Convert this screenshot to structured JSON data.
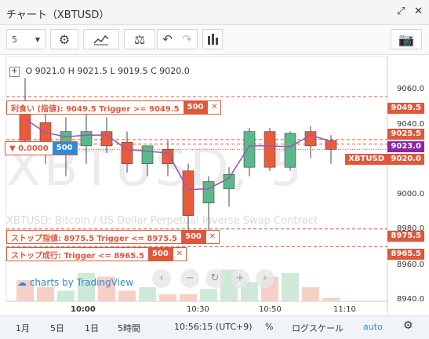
{
  "window": {
    "title": "チャート（XBTUSD）"
  },
  "toolbar": {
    "interval": "5"
  },
  "ohlc": {
    "o_label": "O",
    "o": "9021.0",
    "h_label": "H",
    "h": "9021.5",
    "l_label": "L",
    "l": "9019.5",
    "c_label": "C",
    "c": "9020.0"
  },
  "orders": [
    {
      "text": "利食い (指値): 9049.5 Trigger >= 9049.5",
      "qty": "500"
    },
    {
      "text": "▼ 0.0000",
      "qty": "500"
    },
    {
      "text": "ストップ指値: 8975.5 Trigger <= 8975.5",
      "qty": "500"
    },
    {
      "text": "ストップ成行: Trigger <= 8965.5",
      "qty": "500"
    }
  ],
  "price_axis": {
    "ticks": [
      "9060.0",
      "9040.0",
      "9000.0",
      "8980.0",
      "8960.0",
      "8940.0"
    ]
  },
  "price_tags": {
    "tp": "9049.5",
    "t1": "9025.5",
    "t2": "9023.0",
    "xbt": "XBTUSD",
    "last": "9020.0",
    "sl1": "8975.5",
    "sl2": "8965.5"
  },
  "time_axis": {
    "ticks": [
      "10:00",
      "10:30",
      "10:50",
      "11:10"
    ]
  },
  "watermark": {
    "symbol": "XBTUSD, 5",
    "desc": "XBTUSD: Bitcoin / US Dollar Perpetual Inverse Swap Contract"
  },
  "branding": {
    "text": "charts by TradingView"
  },
  "bottom": {
    "r1": "1月",
    "r2": "5日",
    "r3": "1日",
    "r4": "5時間",
    "time": "10:56:15 (UTC+9)",
    "pct": "%",
    "log": "ログスケール",
    "auto": "auto"
  },
  "colors": {
    "up": "#5ab88a",
    "down": "#ea5b3c",
    "order": "#e0573a",
    "ma": "#9b59b6",
    "price_tag": "#8e24aa",
    "accent": "#2e8bd6"
  },
  "chart_data": {
    "type": "candlestick",
    "ylim": [
      8935,
      9072
    ],
    "candles": [
      {
        "o": 9045,
        "h": 9060,
        "l": 9020,
        "c": 9025
      },
      {
        "o": 9035,
        "h": 9048,
        "l": 9012,
        "c": 9020
      },
      {
        "o": 9020,
        "h": 9038,
        "l": 9005,
        "c": 9030
      },
      {
        "o": 9022,
        "h": 9040,
        "l": 9012,
        "c": 9030
      },
      {
        "o": 9030,
        "h": 9038,
        "l": 9018,
        "c": 9022
      },
      {
        "o": 9024,
        "h": 9030,
        "l": 9007,
        "c": 9012
      },
      {
        "o": 9012,
        "h": 9022,
        "l": 9005,
        "c": 9022
      },
      {
        "o": 9020,
        "h": 9025,
        "l": 9005,
        "c": 9012
      },
      {
        "o": 9008,
        "h": 9012,
        "l": 8975,
        "c": 8983
      },
      {
        "o": 8990,
        "h": 9005,
        "l": 8970,
        "c": 9002
      },
      {
        "o": 8998,
        "h": 9010,
        "l": 8988,
        "c": 9006
      },
      {
        "o": 9010,
        "h": 9032,
        "l": 9005,
        "c": 9030
      },
      {
        "o": 9030,
        "h": 9032,
        "l": 9008,
        "c": 9010
      },
      {
        "o": 9010,
        "h": 9030,
        "l": 9008,
        "c": 9029
      },
      {
        "o": 9030,
        "h": 9033,
        "l": 9015,
        "c": 9022
      },
      {
        "o": 9025,
        "h": 9028,
        "l": 9012,
        "c": 9020
      }
    ],
    "volumes": [
      60,
      40,
      30,
      80,
      70,
      30,
      40,
      20,
      20,
      35,
      90,
      55,
      70,
      80,
      40,
      10
    ]
  }
}
